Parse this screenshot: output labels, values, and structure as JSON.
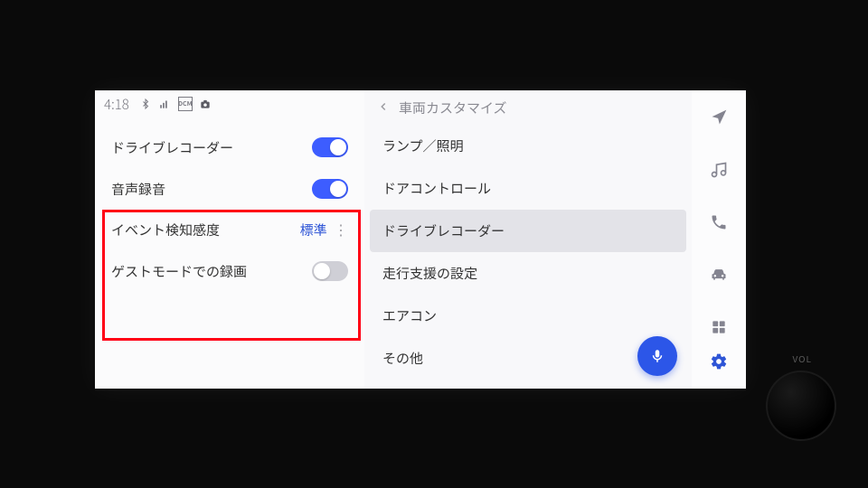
{
  "status": {
    "clock": "4:18",
    "icons": [
      "bluetooth-icon",
      "signal-icon",
      "dcm-icon",
      "camera-icon"
    ]
  },
  "left": {
    "rows": [
      {
        "label": "ドライブレコーダー",
        "type": "toggle",
        "value": true
      },
      {
        "label": "音声録音",
        "type": "toggle",
        "value": true
      },
      {
        "label": "イベント検知感度",
        "type": "link",
        "value": "標準"
      },
      {
        "label": "ゲストモードでの録画",
        "type": "toggle",
        "value": false
      }
    ]
  },
  "mid": {
    "header": "車両カスタマイズ",
    "items": [
      {
        "label": "ランプ／照明",
        "selected": false
      },
      {
        "label": "ドアコントロール",
        "selected": false
      },
      {
        "label": "ドライブレコーダー",
        "selected": true
      },
      {
        "label": "走行支援の設定",
        "selected": false
      },
      {
        "label": "エアコン",
        "selected": false
      },
      {
        "label": "その他",
        "selected": false
      }
    ]
  },
  "rail": {
    "nav": "nav-icon",
    "music": "music-icon",
    "phone": "phone-icon",
    "car": "car-icon",
    "apps": "apps-icon",
    "settings": "settings-icon"
  },
  "physical": {
    "vol_label": "VOL"
  }
}
